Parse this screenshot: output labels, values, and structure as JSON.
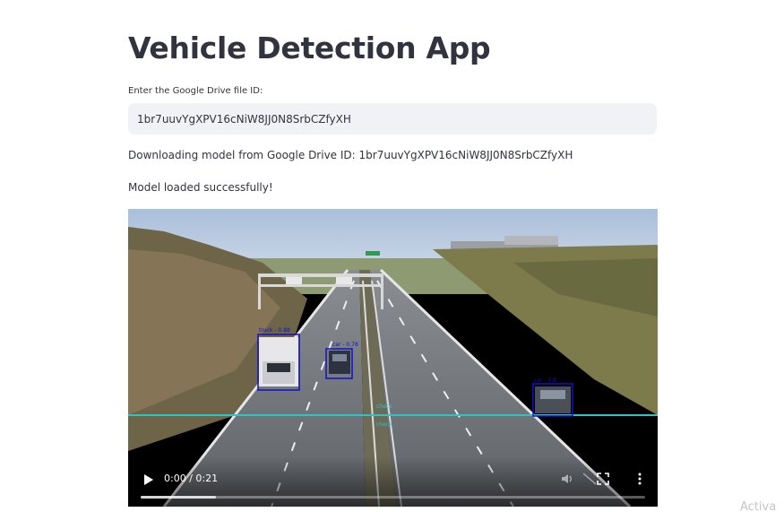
{
  "page": {
    "title": "Vehicle Detection App",
    "input_label": "Enter the Google Drive file ID:",
    "input_value": "1br7uuvYgXPV16cNiW8JJ0N8SrbCZfyXH",
    "download_message": "Downloading model from Google Drive ID: 1br7uuvYgXPV16cNiW8JJ0N8SrbCZfyXH",
    "loaded_message": "Model loaded successfully!"
  },
  "video": {
    "time": "0:00 / 0:21",
    "progress_fraction": 0.15,
    "detections": [
      {
        "label": "truck - 0.88"
      },
      {
        "label": "car - 0.78"
      },
      {
        "label": "car - 0.8"
      }
    ],
    "line_labels": [
      "check",
      "check"
    ],
    "icons": {
      "play": "play-icon",
      "volume": "volume-icon",
      "fullscreen": "fullscreen-icon",
      "menu": "more-options-icon"
    }
  },
  "watermark": "Activa",
  "colors": {
    "detection_box": "#1010c8",
    "count_line": "#22c7d6",
    "input_bg": "#f0f2f6"
  }
}
